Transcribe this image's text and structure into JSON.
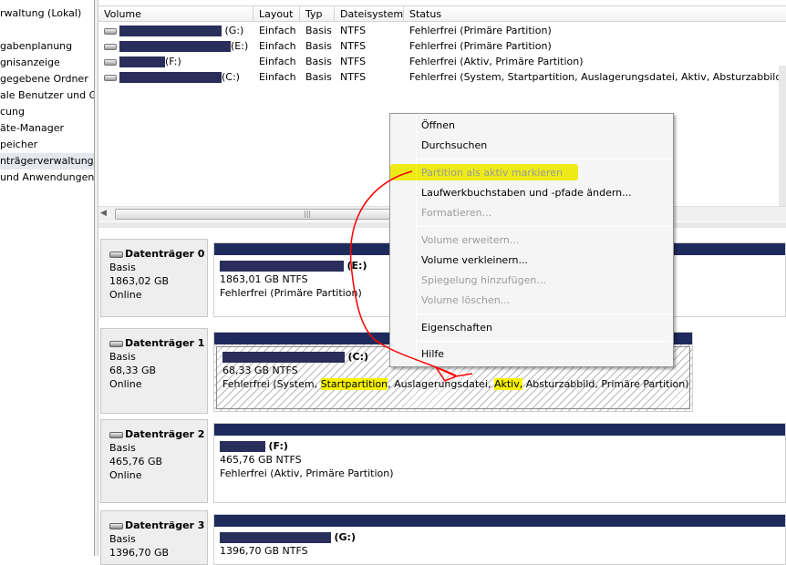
{
  "tree": {
    "items": [
      {
        "label": "rwaltung (Lokal)"
      },
      {
        "label": "gabenplanung"
      },
      {
        "label": "gnisanzeige"
      },
      {
        "label": "gegebene Ordner"
      },
      {
        "label": "ale Benutzer und Gru"
      },
      {
        "label": "cung"
      },
      {
        "label": "äte-Manager"
      },
      {
        "label": "peicher"
      },
      {
        "label": "nträgerverwaltung"
      },
      {
        "label": "und Anwendungen"
      }
    ]
  },
  "volume_table": {
    "columns": [
      "Volume",
      "Layout",
      "Typ",
      "Dateisystem",
      "Status"
    ],
    "rows": [
      {
        "volume": "(G:)",
        "layout": "Einfach",
        "typ": "Basis",
        "fs": "NTFS",
        "status": "Fehlerfrei (Primäre Partition)"
      },
      {
        "volume": "(E:)",
        "layout": "Einfach",
        "typ": "Basis",
        "fs": "NTFS",
        "status": "Fehlerfrei (Primäre Partition)"
      },
      {
        "volume": "(F:)",
        "layout": "Einfach",
        "typ": "Basis",
        "fs": "NTFS",
        "status": "Fehlerfrei (Aktiv, Primäre Partition)"
      },
      {
        "volume": "(C:)",
        "layout": "Einfach",
        "typ": "Basis",
        "fs": "NTFS",
        "status": "Fehlerfrei (System, Startpartition, Auslagerungsdatei, Aktiv, Absturzabbild, Primäre Partition)"
      }
    ]
  },
  "disks": [
    {
      "name": "Datenträger 0",
      "type": "Basis",
      "size": "1863,02 GB",
      "state": "Online",
      "partition": {
        "letter": "(E:)",
        "size": "1863,01 GB NTFS",
        "status": "Fehlerfrei (Primäre Partition)"
      }
    },
    {
      "name": "Datenträger 1",
      "type": "Basis",
      "size": "68,33 GB",
      "state": "Online",
      "partition": {
        "letter": "(C:)",
        "size": "68,33 GB NTFS",
        "status_parts": [
          "Fehlerfrei (System, ",
          "Startpartition",
          ", Auslagerungsdatei, ",
          "Aktiv,",
          " Absturzabbild, Primäre Partition)"
        ]
      }
    },
    {
      "name": "Datenträger 2",
      "type": "Basis",
      "size": "465,76 GB",
      "state": "Online",
      "partition": {
        "letter": "(F:)",
        "size": "465,76 GB NTFS",
        "status": "Fehlerfrei (Aktiv, Primäre Partition)"
      }
    },
    {
      "name": "Datenträger 3",
      "type": "Basis",
      "size": "1396,70 GB",
      "state": "",
      "partition": {
        "letter": "(G:)",
        "size": "1396,70 GB NTFS",
        "status": ""
      }
    }
  ],
  "context_menu": {
    "items": [
      {
        "label": "Öffnen",
        "enabled": true
      },
      {
        "label": "Durchsuchen",
        "enabled": true
      },
      {
        "label": "Partition als aktiv markieren",
        "enabled": false
      },
      {
        "label": "Laufwerkbuchstaben und -pfade ändern...",
        "enabled": true
      },
      {
        "label": "Formatieren...",
        "enabled": false
      },
      {
        "label": "Volume erweitern...",
        "enabled": false
      },
      {
        "label": "Volume verkleinern...",
        "enabled": true
      },
      {
        "label": "Spiegelung hinzufügen...",
        "enabled": false
      },
      {
        "label": "Volume löschen...",
        "enabled": false
      },
      {
        "label": "Eigenschaften",
        "enabled": true
      },
      {
        "label": "Hilfe",
        "enabled": true
      }
    ]
  },
  "colors": {
    "partition_bar": "#1f2a5c",
    "highlight": "#f7f300",
    "annotation_arrow": "#ff0000"
  }
}
